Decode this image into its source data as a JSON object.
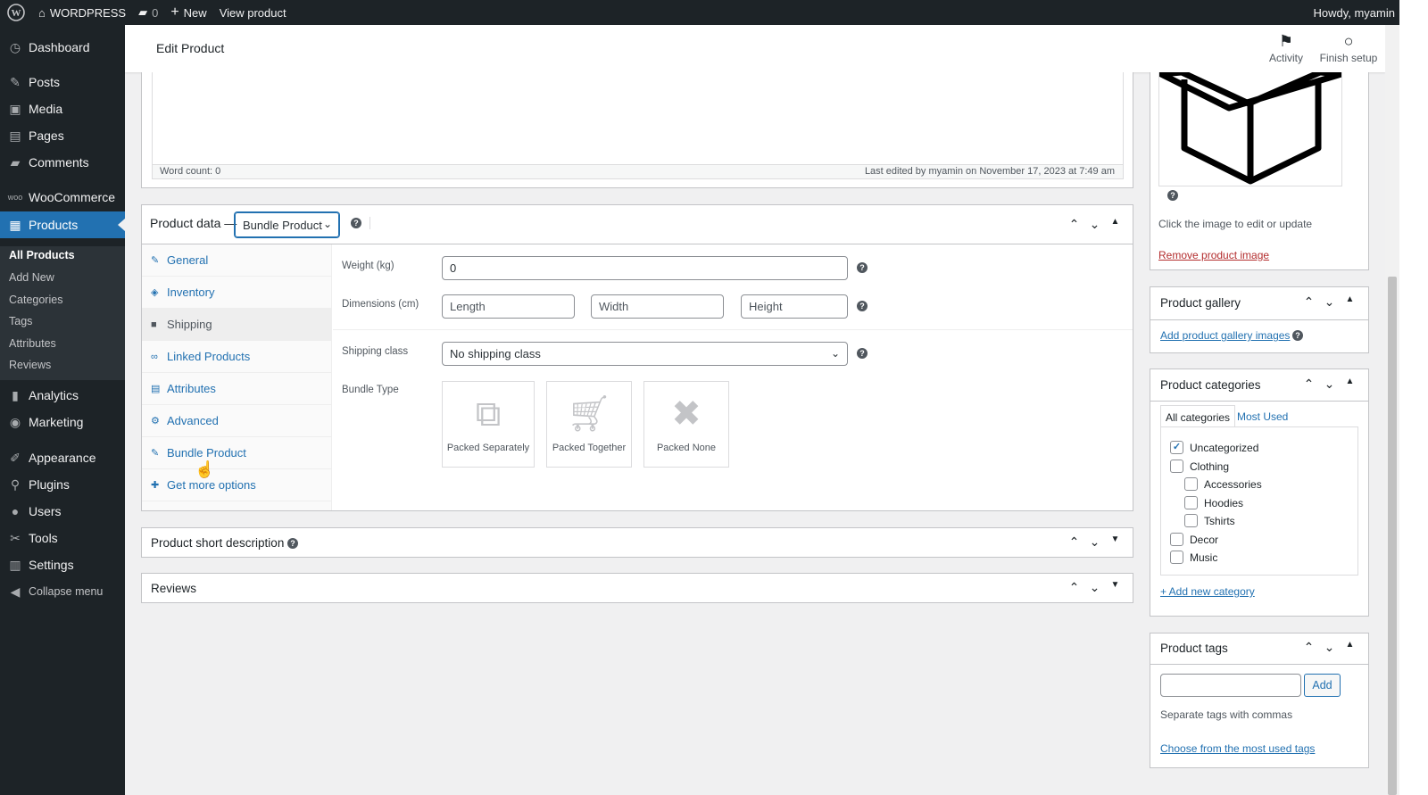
{
  "admin_bar": {
    "site_name": "WORDPRESS",
    "comments_count": "0",
    "new_label": "New",
    "view_label": "View product",
    "howdy": "Howdy, myamin"
  },
  "sidebar": {
    "items": [
      {
        "label": "Dashboard",
        "icon": "dashboard-icon"
      },
      {
        "label": "Posts",
        "icon": "pin-icon"
      },
      {
        "label": "Media",
        "icon": "media-icon"
      },
      {
        "label": "Pages",
        "icon": "pages-icon"
      },
      {
        "label": "Comments",
        "icon": "comment-icon"
      },
      {
        "label": "WooCommerce",
        "icon": "woocommerce-icon"
      },
      {
        "label": "Products",
        "icon": "products-icon"
      },
      {
        "label": "Analytics",
        "icon": "chart-icon"
      },
      {
        "label": "Marketing",
        "icon": "megaphone-icon"
      },
      {
        "label": "Appearance",
        "icon": "brush-icon"
      },
      {
        "label": "Plugins",
        "icon": "plug-icon"
      },
      {
        "label": "Users",
        "icon": "user-icon"
      },
      {
        "label": "Tools",
        "icon": "wrench-icon"
      },
      {
        "label": "Settings",
        "icon": "settings-icon"
      },
      {
        "label": "Collapse menu",
        "icon": "collapse-icon"
      }
    ],
    "submenu": [
      "All Products",
      "Add New",
      "Categories",
      "Tags",
      "Attributes",
      "Reviews"
    ]
  },
  "header": {
    "title": "Edit Product",
    "activity": "Activity",
    "finish_setup": "Finish setup"
  },
  "editor": {
    "word_count": "Word count: 0",
    "last_edited": "Last edited by myamin on November 17, 2023 at 7:49 am"
  },
  "product_data": {
    "label": "Product data —",
    "type": "Bundle Product",
    "tabs": [
      "General",
      "Inventory",
      "Shipping",
      "Linked Products",
      "Attributes",
      "Advanced",
      "Bundle Product",
      "Get more options"
    ],
    "active_tab": "Shipping",
    "weight_label": "Weight (kg)",
    "weight_value": "0",
    "dimensions_label": "Dimensions (cm)",
    "length_placeholder": "Length",
    "width_placeholder": "Width",
    "height_placeholder": "Height",
    "shipping_class_label": "Shipping class",
    "shipping_class_value": "No shipping class",
    "bundle_type_label": "Bundle Type",
    "bundle_types": [
      "Packed Separately",
      "Packed Together",
      "Packed None"
    ]
  },
  "short_description": {
    "title": "Product short description"
  },
  "reviews": {
    "title": "Reviews"
  },
  "product_image": {
    "hint": "Click the image to edit or update",
    "remove": "Remove product image"
  },
  "gallery": {
    "title": "Product gallery",
    "add_link": "Add product gallery images"
  },
  "categories": {
    "title": "Product categories",
    "tab_all": "All categories",
    "tab_most": "Most Used",
    "items": [
      {
        "label": "Uncategorized",
        "checked": true
      },
      {
        "label": "Clothing",
        "checked": false
      },
      {
        "label": "Accessories",
        "checked": false
      },
      {
        "label": "Hoodies",
        "checked": false
      },
      {
        "label": "Tshirts",
        "checked": false
      },
      {
        "label": "Decor",
        "checked": false
      },
      {
        "label": "Music",
        "checked": false
      }
    ],
    "add_new": "+ Add new category"
  },
  "tags": {
    "title": "Product tags",
    "add_button": "Add",
    "hint": "Separate tags with commas",
    "choose_link": "Choose from the most used tags"
  },
  "colors": {
    "admin_dark": "#1d2327",
    "accent": "#2271b1",
    "link_danger": "#b32d2e"
  }
}
